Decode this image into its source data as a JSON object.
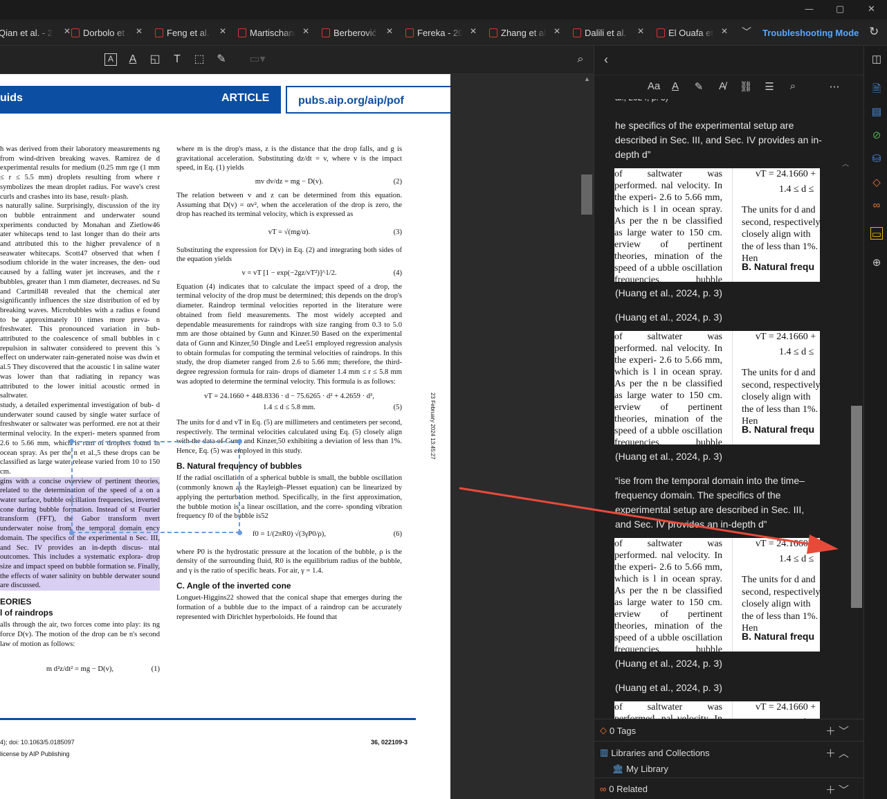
{
  "window": {
    "minimize": "—",
    "maximize": "▢",
    "close": "✕"
  },
  "tabs": [
    {
      "label": "Qian et al. - 2"
    },
    {
      "label": "Dorbolo et al"
    },
    {
      "label": "Feng et al. -"
    },
    {
      "label": "Martischang"
    },
    {
      "label": "Berberović e"
    },
    {
      "label": "Fereka - 202"
    },
    {
      "label": "Zhang et al."
    },
    {
      "label": "Dalili et al. -"
    },
    {
      "label": "El Ouafa et"
    }
  ],
  "troubleshooting_label": "Troubleshooting Mode",
  "page": {
    "journal": "uids",
    "article": "ARTICLE",
    "url": "pubs.aip.org/aip/pof",
    "doi": "4); doi: 10.1063/5.0185097",
    "license": "license by AIP Publishing",
    "page_number": "36, 022109-3",
    "side_date": "23 February 2024 13:45:27",
    "left_col": [
      "h was derived from their laboratory measurements ng from wind-driven breaking waves. Ramirez de d experimental results for medium (0.25 mm rge (1 mm ≤ r ≤ 5.5 mm) droplets resulting from where r symbolizes the mean droplet radius. For wave's crest curls and crashes into its base, result- plash.",
      "s naturally saline. Surprisingly, discussion of the ity on bubble entrainment and underwater sound xperiments conducted by Monahan and Zietlow46 ater whitecaps tend to last longer than do their arts and attributed this to the higher prevalence of n seawater whitecaps. Scott47 observed that when f sodium chloride in the water increases, the den- oud caused by a falling water jet increases, and the r bubbles, greater than 1 mm diameter, decreases. nd Su and Cartmill48 revealed that the chemical ater significantly influences the size distribution of ed by breaking waves. Microbubbles with a radius e found to be approximately 10 times more preva- n freshwater. This pronounced variation in bub- attributed to the coalescence of small bubbles in c repulsion in saltwater considered to prevent this 's effect on underwater rain-generated noise was dwin et al.5 They discovered that the acoustic l in saline water was lower than that radiating in repancy was attributed to the lower initial acoustic ormed in saltwater.",
      "study, a detailed experimental investigation of bub- d underwater sound caused by single water surface of freshwater or saltwater was performed. ere not at their terminal velocity. In the experi- meters spanned from 2.6 to 5.66 mm, which is rum of droplets found in ocean spray. As per the n et al.,5 these drops can be classified as large water release varied from 10 to 150 cm.",
      "gins with a concise overview of pertinent theories, related to the determination of the speed of a on a water surface, bubble oscillation frequencies, inverted cone during bubble formation. Instead of st Fourier transform (FFT), the Gabor transform nvert underwater noise from the temporal domain ency domain. The specifics of the experimental n Sec. III, and Sec. IV provides an in-depth discus- ntal outcomes. This includes a systematic explora- drop size and impact speed on bubble formation se. Finally, the effects of water salinity on bubble derwater sound are discussed."
    ],
    "left_heading1": "EORIES",
    "left_heading2": "l of raindrops",
    "left_col_end": "alls through the air, two forces come into play: its ng force D(v). The motion of the drop can be n's second law of motion as follows:",
    "eq1": "m d²z/dt² = mg − D(v),",
    "eq1_no": "(1)",
    "right_col_p1": "where m is the drop's mass, z is the distance that the drop falls, and g is gravitational acceleration. Substituting dz/dt = v, where v is the impact speed, in Eq. (1) yields",
    "eq2": "mv dv/dz = mg − D(v).",
    "eq2_no": "(2)",
    "right_col_p2": "The relation between v and z can be determined from this equation. Assuming that D(v) = αv², when the acceleration of the drop is zero, the drop has reached its terminal velocity, which is expressed as",
    "eq3": "vT = √(mg/α).",
    "eq3_no": "(3)",
    "right_col_p3": "Substituting the expression for D(v) in Eq. (2) and integrating both sides of the equation yields",
    "eq4": "v = vT [1 − exp(−2gz/vT²)]^1/2.",
    "eq4_no": "(4)",
    "right_col_p4": "Equation (4) indicates that to calculate the impact speed of a drop, the terminal velocity of the drop must be determined; this depends on the drop's diameter. Raindrop terminal velocities reported in the literature were obtained from field measurements. The most widely accepted and dependable measurements for raindrops with size ranging from 0.3 to 5.0 mm are those obtained by Gunn and Kinzer.50 Based on the experimental data of Gunn and Kinzer,50 Dingle and Lee51 employed regression analysis to obtain formulas for computing the terminal velocities of raindrops. In this study, the drop diameter ranged from 2.6 to 5.66 mm; therefore, the third-degree regression formula for rain- drops of diameter 1.4 mm ≤ r ≤ 5.8 mm was adopted to determine the terminal velocity. This formula is as follows:",
    "eq5a": "vT = 24.1660 + 448.8336 · d − 75.6265 · d² + 4.2659 · d³,",
    "eq5b": "1.4 ≤ d ≤ 5.8 mm.",
    "eq5_no": "(5)",
    "right_col_p5": "The units for d and vT in Eq. (5) are millimeters and centimeters per second, respectively. The terminal velocities calculated using Eq. (5) closely align with the data of Gunn and Kinzer,50 exhibiting a deviation of less than 1%. Hence, Eq. (5) was employed in this study.",
    "sec_b": "B. Natural frequency of bubbles",
    "right_col_p6": "If the radial oscillation of a spherical bubble is small, the bubble oscillation (commonly known as the Rayleigh–Plesset equation) can be linearized by applying the perturbation method. Specifically, in the first approximation, the bubble motion is a linear oscillation, and the corre- sponding vibration frequency f0 of the bubble is52",
    "eq6": "f0 = 1/(2πR0) √(3γP0/ρ),",
    "eq6_no": "(6)",
    "right_col_p7": "where P0 is the hydrostatic pressure at the location of the bubble, ρ is the density of the surrounding fluid, R0 is the equilibrium radius of the bubble, and γ is the ratio of specific heats. For air, γ = 1.4.",
    "sec_c": "C. Angle of the inverted cone",
    "right_col_p8": "Longuet-Higgins22 showed that the conical shape that emerges during the formation of a bubble due to the impact of a raindrop can be accurately represented with Dirichlet hyperboloids. He found that"
  },
  "notes": {
    "top_fragment": "al., 2024, p. 3)",
    "quote1": "he specifics of the experimental setup are described in Sec. III, and Sec. IV provides an in-depth d”",
    "cite": "(Huang et al., 2024, p. 3)",
    "quote2": "“ise from the temporal domain into the time–frequency domain. The specifics of the experimental setup are described in Sec. III, and Sec. IV provides an in-depth d”",
    "snippet": {
      "left": "of saltwater was performed. nal velocity. In the experi- 2.6 to 5.66 mm, which is l in ocean spray. As per the n be classified as large water to 150 cm. erview of pertinent theories, mination of the speed of a ubble oscillation frequencies, bubble formation. Instead of",
      "eq_a": "vT = 24.1660 +",
      "eq_b": "1.4 ≤ d ≤",
      "right": "The units for d and second, respectively closely align with the of less than 1%. Hen",
      "heading": "B. Natural frequ"
    }
  },
  "sections": {
    "tags": "0 Tags",
    "libraries": "Libraries and Collections",
    "my_library": "My Library",
    "related": "0 Related"
  }
}
